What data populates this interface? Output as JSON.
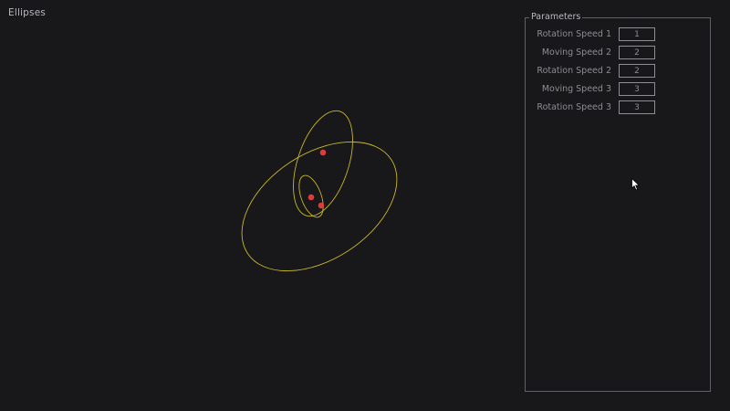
{
  "window": {
    "title": "Ellipses"
  },
  "panel": {
    "title": "Parameters",
    "params": [
      {
        "label": "Rotation Speed 1",
        "value": "1"
      },
      {
        "label": "Moving Speed 2",
        "value": "2"
      },
      {
        "label": "Rotation Speed 2",
        "value": "2"
      },
      {
        "label": "Moving Speed 3",
        "value": "3"
      },
      {
        "label": "Rotation Speed 3",
        "value": "3"
      }
    ]
  },
  "colors": {
    "background": "#18171a",
    "ellipse": "#c8b828",
    "point": "#e03a3a",
    "text": "#b9b9bd",
    "muted": "#8d8d92"
  },
  "cursor_icon": "mouse-pointer-icon"
}
